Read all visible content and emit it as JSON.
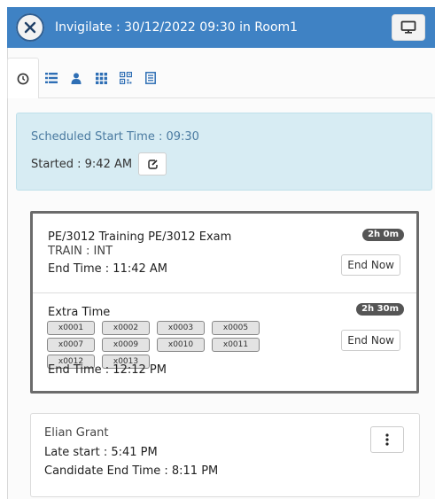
{
  "header": {
    "title": "Invigilate : 30/12/2022 09:30 in Room1",
    "close_icon": "close-icon",
    "monitor_icon": "monitor-icon"
  },
  "tabs": [
    {
      "icon": "clock-icon",
      "active": true
    },
    {
      "icon": "list-icon",
      "active": false
    },
    {
      "icon": "person-icon",
      "active": false
    },
    {
      "icon": "grid-icon",
      "active": false
    },
    {
      "icon": "qrcode-icon",
      "active": false
    },
    {
      "icon": "document-icon",
      "active": false
    }
  ],
  "schedule": {
    "scheduled_label": "Scheduled Start Time : 09:30",
    "started_label": "Started : 9:42 AM"
  },
  "exam": {
    "title": "PE/3012 Training PE/3012 Exam",
    "subtitle": "TRAIN : INT",
    "end_time": "End Time : 11:42 AM",
    "duration": "2h 0m",
    "end_now": "End Now"
  },
  "extra_time": {
    "title": "Extra Time",
    "duration": "2h 30m",
    "candidates": [
      "x0001",
      "x0002",
      "x0003",
      "x0005",
      "x0007",
      "x0009",
      "x0010",
      "x0011",
      "x0012",
      "x0013"
    ],
    "end_time": "End Time : 12:12 PM",
    "end_now": "End Now"
  },
  "candidate": {
    "name": "Elian Grant",
    "late_start": "Late start : 5:41 PM",
    "end_time": "Candidate End Time : 8:11 PM",
    "menu_icon": "kebab-icon"
  },
  "colors": {
    "header": "#3f82c4",
    "schedule_bg": "#d7ecf3",
    "badge": "#555555"
  }
}
